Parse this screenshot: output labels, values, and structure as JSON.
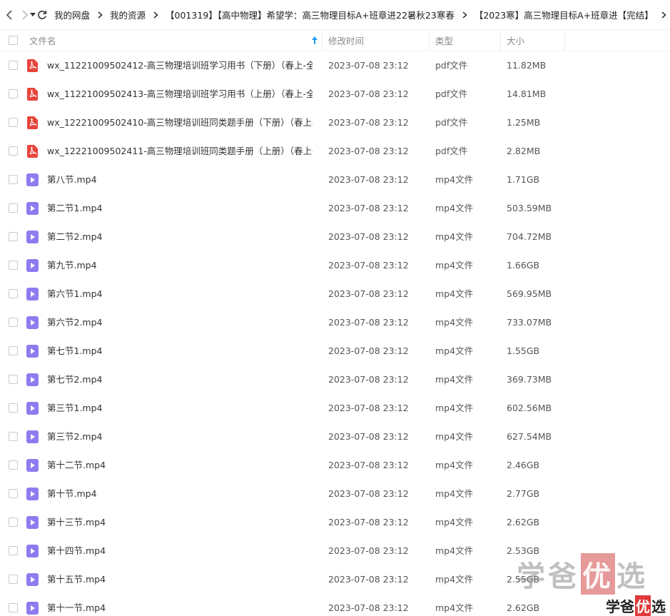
{
  "nav": {
    "breadcrumbs": [
      "我的网盘",
      "我的资源",
      "【001319】【高中物理】希望学：高三物理目标A+班章进22暑秋23寒春",
      "【2023寒】高三物理目标A+班章进【完结】"
    ]
  },
  "header": {
    "name": "文件名",
    "modified": "修改时间",
    "type": "类型",
    "size": "大小"
  },
  "files": [
    {
      "name": "wx_11221009502412-高三物理培训班学习用书（下册）（春上-全...",
      "time": "2023-07-08 23:12",
      "type": "pdf文件",
      "size": "11.82MB",
      "icon": "pdf-icon"
    },
    {
      "name": "wx_11221009502413-高三物理培训班学习用书（上册）（春上-全...",
      "time": "2023-07-08 23:12",
      "type": "pdf文件",
      "size": "14.81MB",
      "icon": "pdf-icon"
    },
    {
      "name": "wx_12221009502410-高三物理培训班同类题手册（下册）（春上-...",
      "time": "2023-07-08 23:12",
      "type": "pdf文件",
      "size": "1.25MB",
      "icon": "pdf-icon"
    },
    {
      "name": "wx_12221009502411-高三物理培训班同类题手册（上册）（春上-...",
      "time": "2023-07-08 23:12",
      "type": "pdf文件",
      "size": "2.82MB",
      "icon": "pdf-icon"
    },
    {
      "name": "第八节.mp4",
      "time": "2023-07-08 23:12",
      "type": "mp4文件",
      "size": "1.71GB",
      "icon": "video-icon"
    },
    {
      "name": "第二节1.mp4",
      "time": "2023-07-08 23:12",
      "type": "mp4文件",
      "size": "503.59MB",
      "icon": "video-icon"
    },
    {
      "name": "第二节2.mp4",
      "time": "2023-07-08 23:12",
      "type": "mp4文件",
      "size": "704.72MB",
      "icon": "video-icon"
    },
    {
      "name": "第九节.mp4",
      "time": "2023-07-08 23:12",
      "type": "mp4文件",
      "size": "1.66GB",
      "icon": "video-icon"
    },
    {
      "name": "第六节1.mp4",
      "time": "2023-07-08 23:12",
      "type": "mp4文件",
      "size": "569.95MB",
      "icon": "video-icon"
    },
    {
      "name": "第六节2.mp4",
      "time": "2023-07-08 23:12",
      "type": "mp4文件",
      "size": "733.07MB",
      "icon": "video-icon"
    },
    {
      "name": "第七节1.mp4",
      "time": "2023-07-08 23:12",
      "type": "mp4文件",
      "size": "1.55GB",
      "icon": "video-icon"
    },
    {
      "name": "第七节2.mp4",
      "time": "2023-07-08 23:12",
      "type": "mp4文件",
      "size": "369.73MB",
      "icon": "video-icon"
    },
    {
      "name": "第三节1.mp4",
      "time": "2023-07-08 23:12",
      "type": "mp4文件",
      "size": "602.56MB",
      "icon": "video-icon"
    },
    {
      "name": "第三节2.mp4",
      "time": "2023-07-08 23:12",
      "type": "mp4文件",
      "size": "627.54MB",
      "icon": "video-icon"
    },
    {
      "name": "第十二节.mp4",
      "time": "2023-07-08 23:12",
      "type": "mp4文件",
      "size": "2.46GB",
      "icon": "video-icon"
    },
    {
      "name": "第十节.mp4",
      "time": "2023-07-08 23:12",
      "type": "mp4文件",
      "size": "2.77GB",
      "icon": "video-icon"
    },
    {
      "name": "第十三节.mp4",
      "time": "2023-07-08 23:12",
      "type": "mp4文件",
      "size": "2.62GB",
      "icon": "video-icon"
    },
    {
      "name": "第十四节.mp4",
      "time": "2023-07-08 23:12",
      "type": "mp4文件",
      "size": "2.53GB",
      "icon": "video-icon"
    },
    {
      "name": "第十五节.mp4",
      "time": "2023-07-08 23:12",
      "type": "mp4文件",
      "size": "2.55GB",
      "icon": "video-icon"
    },
    {
      "name": "第十一节.mp4",
      "time": "2023-07-08 23:12",
      "type": "mp4文件",
      "size": "2.62GB",
      "icon": "video-icon"
    }
  ],
  "watermark": {
    "big": [
      "学",
      "爸",
      "优",
      "选"
    ],
    "small": [
      "学",
      "爸",
      "优",
      "选"
    ]
  },
  "colors": {
    "pdf": "#e8453c",
    "video": "#8c7cf0",
    "sort": "#1e9bf0"
  }
}
